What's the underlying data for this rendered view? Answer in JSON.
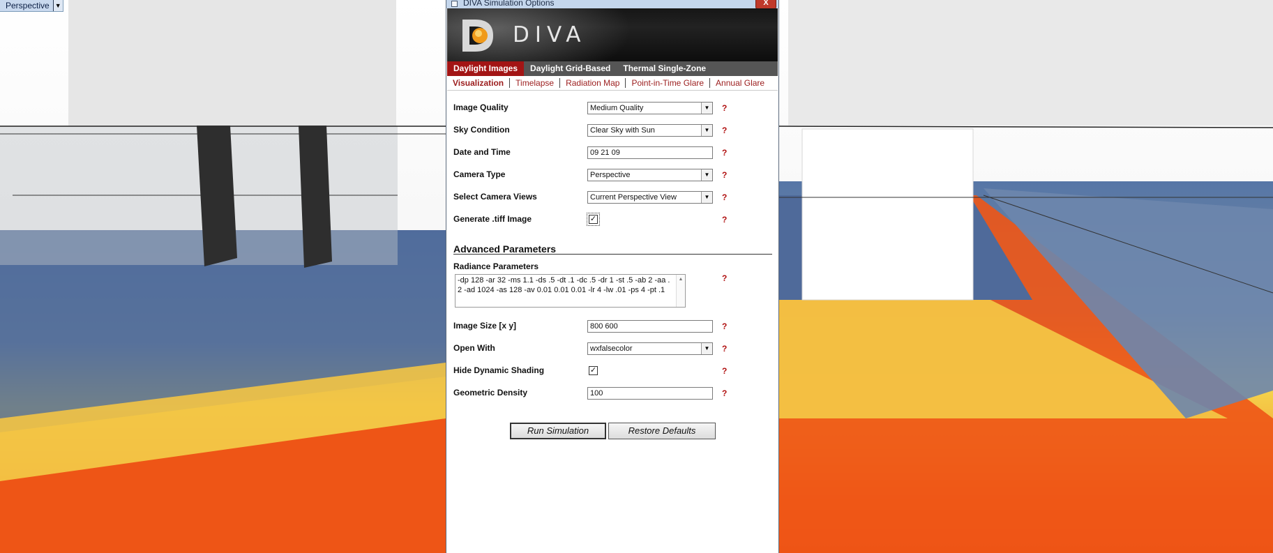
{
  "viewport": {
    "label": "Perspective",
    "dropdown_icon": "triangle-down-icon"
  },
  "dialog": {
    "title": "DIVA Simulation Options",
    "close_label": "X",
    "brand": "DIVA",
    "main_tabs": [
      {
        "label": "Daylight Images",
        "active": true
      },
      {
        "label": "Daylight Grid-Based",
        "active": false
      },
      {
        "label": "Thermal Single-Zone",
        "active": false
      }
    ],
    "sub_tabs": [
      {
        "label": "Visualization",
        "active": true
      },
      {
        "label": "Timelapse",
        "active": false
      },
      {
        "label": "Radiation Map",
        "active": false
      },
      {
        "label": "Point-in-Time Glare",
        "active": false
      },
      {
        "label": "Annual Glare",
        "active": false
      }
    ],
    "fields": {
      "image_quality": {
        "label": "Image Quality",
        "value": "Medium Quality"
      },
      "sky_condition": {
        "label": "Sky Condition",
        "value": "Clear Sky with Sun"
      },
      "date_time": {
        "label": "Date and Time",
        "value": "09 21 09"
      },
      "camera_type": {
        "label": "Camera Type",
        "value": "Perspective"
      },
      "camera_views": {
        "label": "Select Camera Views",
        "value": "Current Perspective View"
      },
      "generate_tiff": {
        "label": "Generate .tiff Image",
        "checked": true
      },
      "advanced_title": "Advanced Parameters",
      "radiance": {
        "label": "Radiance Parameters",
        "value": "-dp 128 -ar 32 -ms 1.1 -ds .5 -dt .1 -dc .5 -dr 1 -st .5 -ab 2 -aa .2 -ad 1024 -as 128 -av 0.01 0.01 0.01 -lr 4 -lw .01 -ps 4 -pt .1"
      },
      "image_size": {
        "label": "Image Size [x y]",
        "value": "800 600"
      },
      "open_with": {
        "label": "Open With",
        "value": "wxfalsecolor"
      },
      "hide_shading": {
        "label": "Hide Dynamic Shading",
        "checked": true
      },
      "geo_density": {
        "label": "Geometric Density",
        "value": "100"
      }
    },
    "help_glyph": "?",
    "check_glyph": "✓",
    "buttons": {
      "run": "Run Simulation",
      "restore": "Restore Defaults"
    }
  }
}
